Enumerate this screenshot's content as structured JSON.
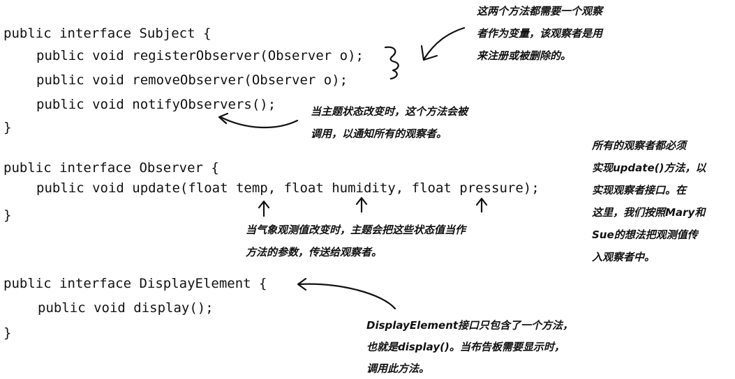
{
  "code": {
    "subject": [
      "public interface Subject {",
      "public void registerObserver(Observer o);",
      "public void removeObserver(Observer o);",
      "public void notifyObservers();",
      "}"
    ],
    "observer": [
      "public interface Observer {",
      "public void update(float temp, float humidity, float pressure);",
      "}"
    ],
    "display": [
      "public interface DisplayElement {",
      "public void display();",
      "}"
    ]
  },
  "annotations": {
    "observer_param": [
      "这两个方法都需要一个观察",
      "者作为变量，该观察者是用",
      "来注册或被删除的。"
    ],
    "notify": [
      "当主题状态改变时，这个方法会被",
      "调用，以通知所有的观察者。"
    ],
    "implement": [
      "所有的观察者都必须",
      "实现update()方法，以",
      "实现观察者接口。在",
      "这里，我们按照Mary和",
      "Sue的想法把观测值传",
      "入观察者中。"
    ],
    "params": [
      "当气象观测值改变时，主题会把这些状态值当作",
      "方法的参数，传送给观察者。"
    ],
    "display": [
      "DisplayElement接口只包含了一个方法，",
      "也就是display()。当布告板需要显示时，",
      "调用此方法。"
    ]
  }
}
